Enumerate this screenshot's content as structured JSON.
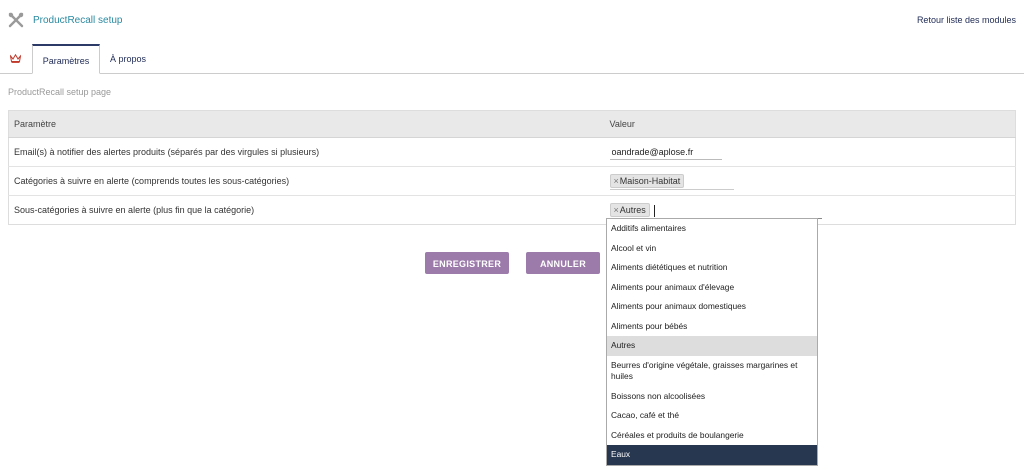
{
  "header": {
    "title": "ProductRecall setup",
    "back_link": "Retour liste des modules"
  },
  "tabs": [
    {
      "label": "Paramètres",
      "active": true
    },
    {
      "label": "À propos",
      "active": false
    }
  ],
  "subtitle": "ProductRecall setup page",
  "table": {
    "headers": [
      "Paramètre",
      "Valeur"
    ],
    "rows": [
      {
        "label": "Email(s) à notifier des alertes produits (séparés par des virgules si plusieurs)",
        "value": "oandrade@aplose.fr"
      },
      {
        "label": "Catégories à suivre en alerte (comprends toutes les sous-catégories)",
        "chip": "Maison-Habitat"
      },
      {
        "label": "Sous-catégories à suivre en alerte (plus fin que la catégorie)",
        "chip": "Autres"
      }
    ]
  },
  "chip_remove_symbol": "×",
  "buttons": {
    "save": "ENREGISTRER",
    "cancel": "ANNULER"
  },
  "dropdown": {
    "options": [
      "Additifs alimentaires",
      "Alcool et vin",
      "Aliments diététiques et nutrition",
      "Aliments pour animaux d'élevage",
      "Aliments pour animaux domestiques",
      "Aliments pour bébés",
      "Autres",
      "Beurres d'origine végétale, graisses margarines et huiles",
      "Boissons non alcoolisées",
      "Cacao, café et thé",
      "Céréales et produits de boulangerie",
      "Eaux"
    ],
    "selected": "Autres",
    "highlighted": "Eaux"
  },
  "colors": {
    "accent_title": "#2a8aa0",
    "button": "#9c7bab",
    "highlight": "#273750"
  }
}
